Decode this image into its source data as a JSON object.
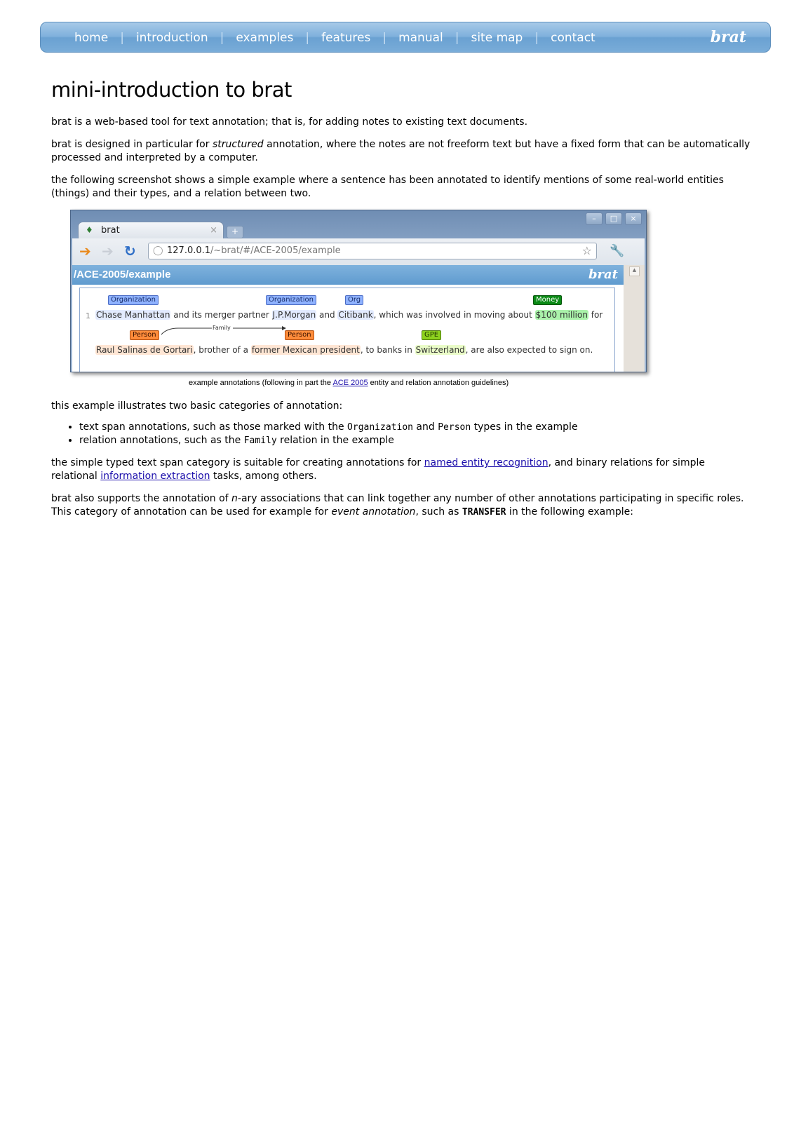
{
  "nav": {
    "items": [
      "home",
      "introduction",
      "examples",
      "features",
      "manual",
      "site map",
      "contact"
    ],
    "separator": "|",
    "logo": "brat"
  },
  "page": {
    "title": "mini-introduction to brat",
    "p1": "brat is a web-based tool for text annotation; that is, for adding notes to existing text documents.",
    "p2_before": "brat is designed in particular for ",
    "p2_em": "structured",
    "p2_after": " annotation, where the notes are not freeform text but have a fixed form that can be automatically processed and interpreted by a computer.",
    "p3": "the following screenshot shows a simple example where a sentence has been annotated to identify mentions of some real-world entities (things) and their types, and a relation between two.",
    "caption_before": "example annotations (following in part the ",
    "caption_link": "ACE 2005",
    "caption_after": " entity and relation annotation guidelines)",
    "p4": "this example illustrates two basic categories of annotation:",
    "li1_strong": "text span",
    "li1_mid": " annotations, such as those marked with the ",
    "li1_code1": "Organization",
    "li1_and": " and ",
    "li1_code2": "Person",
    "li1_end": " types in the example",
    "li2_strong": "relation",
    "li2_mid": " annotations, such as the ",
    "li2_code": "Family",
    "li2_end": " relation in the example",
    "p5_before": "the simple typed text span category is suitable for creating annotations for ",
    "p5_link1": "named entity recognition",
    "p5_mid": ", and binary relations for simple relational ",
    "p5_link2": "information extraction",
    "p5_after": " tasks, among others.",
    "p6_before": "brat also supports the annotation of ",
    "p6_em": "n",
    "p6_strong": "-ary associations",
    "p6_mid": " that can link together any number of other annotations participating in specific roles. This category of annotation can be used for example for ",
    "p6_em2": "event annotation",
    "p6_mid2": ", such as ",
    "p6_code": "TRANSFER",
    "p6_end": " in the following example:"
  },
  "browser": {
    "tab_title": "brat",
    "tab_close": "×",
    "newtab": "+",
    "url_host": "127.0.0.1",
    "url_path": "/~brat/#/ACE-2005/example",
    "doc_title": "/ACE-2005/example",
    "doc_logo": "brat",
    "line_number": "1",
    "win_buttons": [
      "–",
      "□",
      "×"
    ]
  },
  "annotation": {
    "labels": {
      "org1": "Organization",
      "org2": "Organization",
      "org3": "Org",
      "money": "Money",
      "pers1": "Person",
      "pers2": "Person",
      "gpe": "GPE",
      "relation": "Family"
    },
    "line1": {
      "t_chase": "Chase Manhattan",
      "t_1": " and its merger partner ",
      "t_jpm": "J.P.Morgan",
      "t_2": "  and ",
      "t_citi": "Citibank",
      "t_3": ", which was involved in moving about ",
      "t_money": "$100 million",
      "t_4": " for"
    },
    "line2": {
      "t_raul": "Raul Salinas de Gortari",
      "t_1": ", brother of a ",
      "t_fmp": "former Mexican president",
      "t_2": ", to banks in ",
      "t_swiss": "Switzerland",
      "t_3": ", are also expected to sign on."
    },
    "colors": {
      "organization": "#8fb2ff",
      "person": "#ff8c3b",
      "money": "#0b8a16",
      "gpe": "#8dd21e"
    }
  }
}
